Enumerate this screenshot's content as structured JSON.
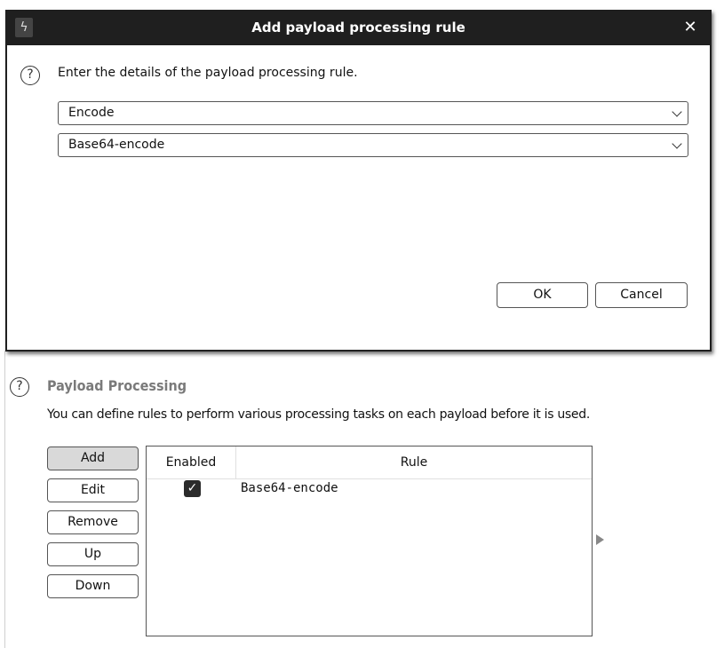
{
  "dialog": {
    "title": "Add payload processing rule",
    "app_icon": "burp-lightning-icon",
    "close_label": "✕",
    "help_glyph": "?",
    "instruction": "Enter the details of the payload processing rule.",
    "rule_type_value": "Encode",
    "rule_subtype_value": "Base64-encode",
    "ok_label": "OK",
    "cancel_label": "Cancel"
  },
  "payload_processing": {
    "help_glyph": "?",
    "title": "Payload Processing",
    "description": "You can define rules to perform various processing tasks on each payload before it is used.",
    "buttons": {
      "add": "Add",
      "edit": "Edit",
      "remove": "Remove",
      "up": "Up",
      "down": "Down"
    },
    "table": {
      "columns": [
        "Enabled",
        "Rule"
      ],
      "rows": [
        {
          "enabled": "✓",
          "rule": "Base64-encode"
        }
      ]
    }
  }
}
